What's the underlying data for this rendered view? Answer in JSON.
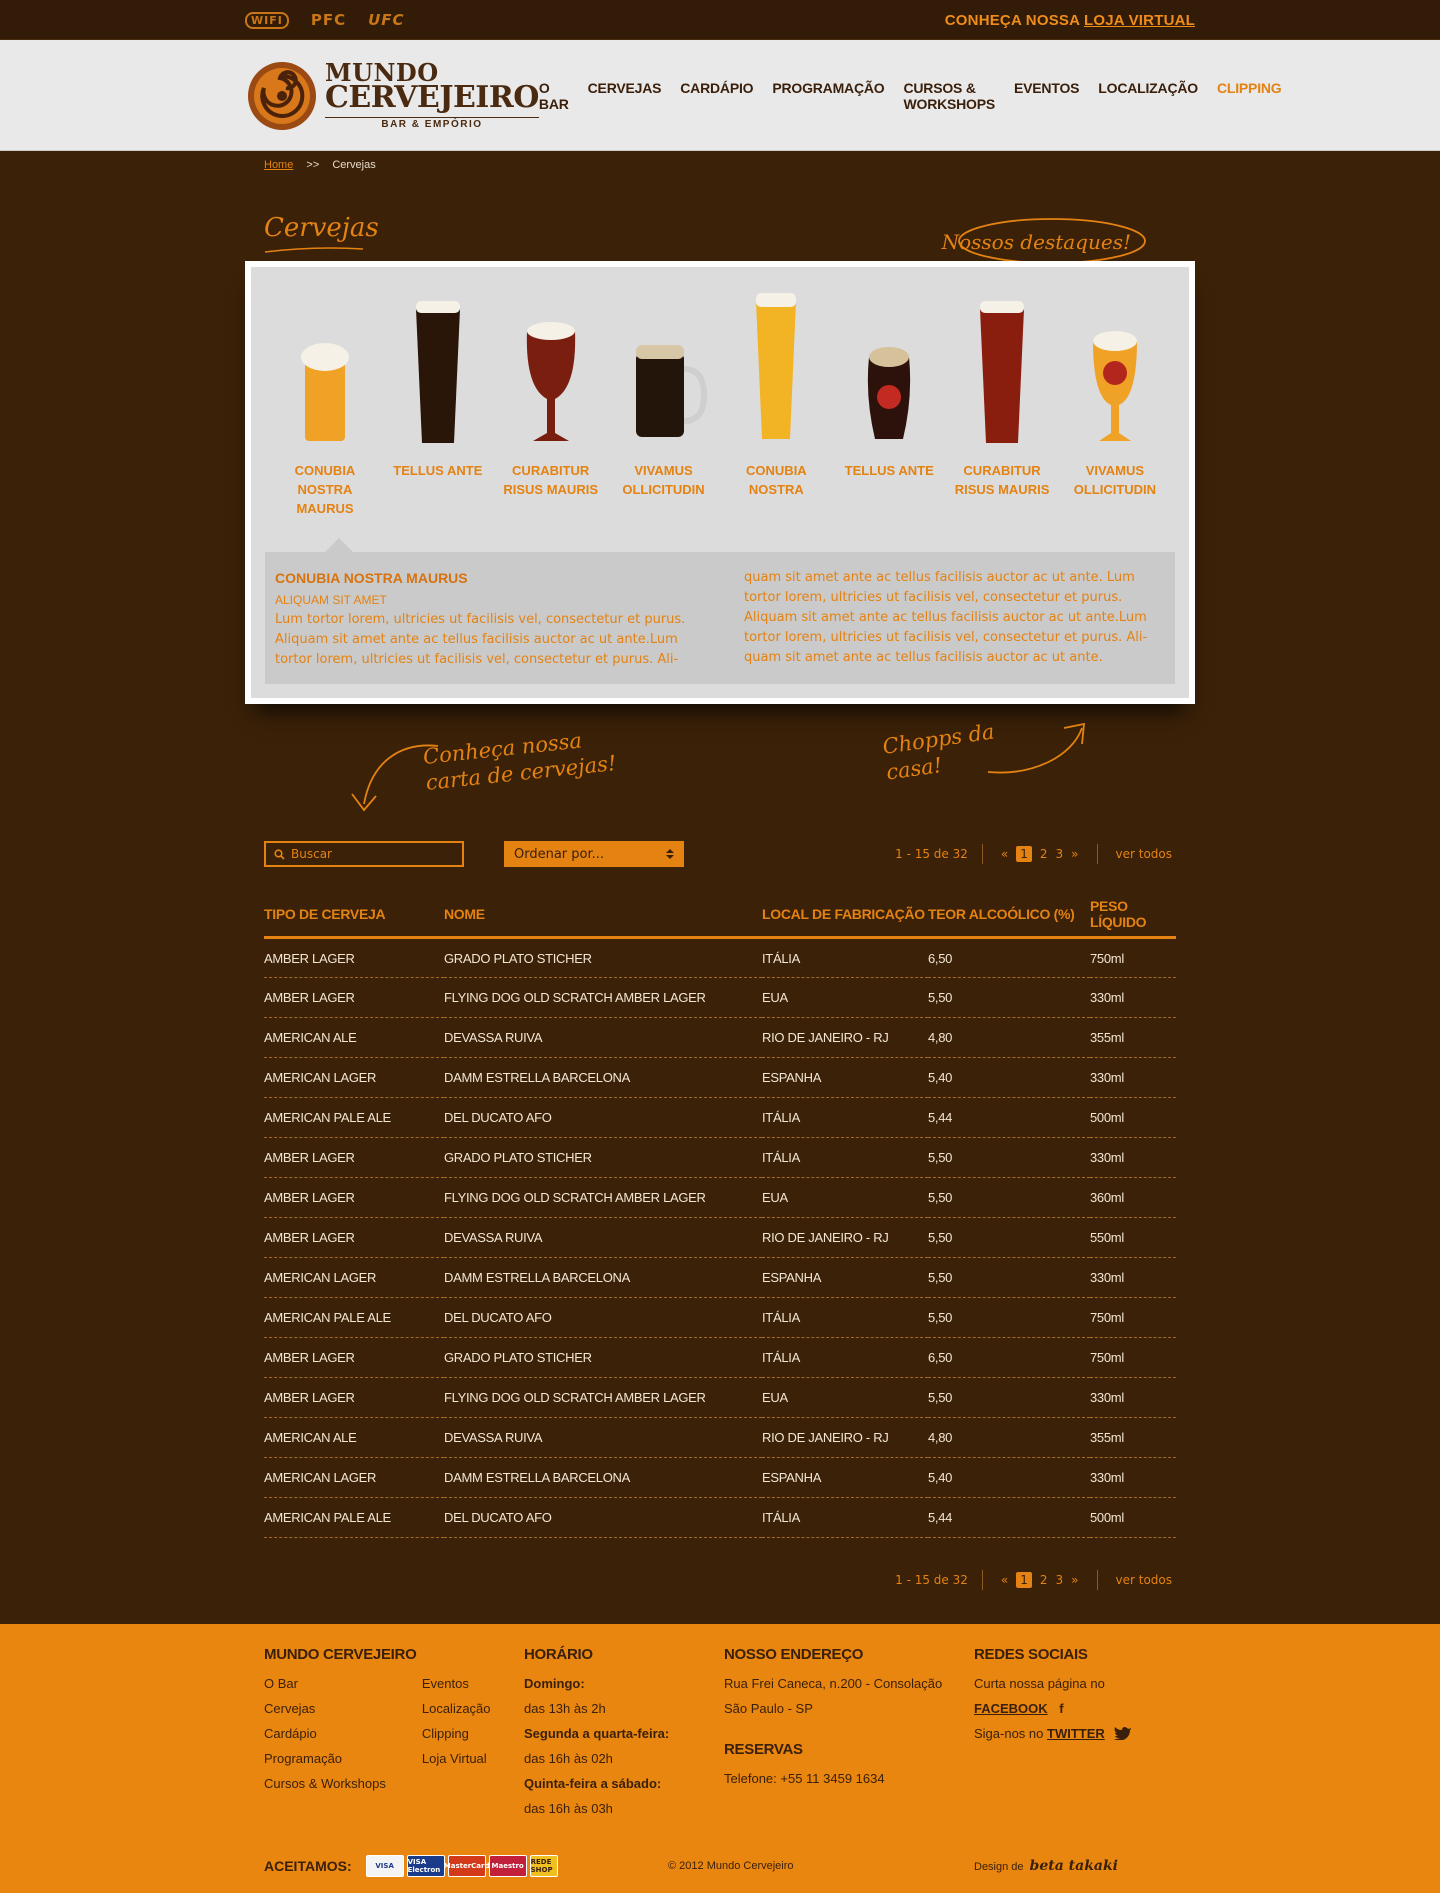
{
  "topbar": {
    "logos": [
      "WIFI",
      "PFC",
      "UFC"
    ],
    "store_prefix": "CONHEÇA NOSSA",
    "store_link": "LOJA VIRTUAL"
  },
  "brand": {
    "line1": "MUNDO",
    "line2": "CERVEJEIRO",
    "line3": "BAR & EMPÓRIO"
  },
  "nav": [
    "O BAR",
    "CERVEJAS",
    "CARDÁPIO",
    "PROGRAMAÇÃO",
    "CURSOS & WORKSHOPS",
    "EVENTOS",
    "LOCALIZAÇÃO",
    "CLIPPING"
  ],
  "nav_active_index": 7,
  "breadcrumb": {
    "home": "Home",
    "separator": ">>",
    "current": "Cervejas"
  },
  "page": {
    "title": "Cervejas",
    "highlights": "Nossos destaques!"
  },
  "featured_beers": [
    {
      "name": "CONUBIA NOSTRA MAURUS",
      "glass": "wheat",
      "color": "#f0a226"
    },
    {
      "name": "TELLUS ANTE",
      "glass": "pint",
      "color": "#2a1608"
    },
    {
      "name": "CURABITUR RISUS MAURIS",
      "glass": "tulip",
      "color": "#7a1e10"
    },
    {
      "name": "VIVAMUS OLLICITUDIN",
      "glass": "mug",
      "color": "#24150a"
    },
    {
      "name": "CONUBIA NOSTRA",
      "glass": "tall",
      "color": "#f2b324"
    },
    {
      "name": "TELLUS ANTE",
      "glass": "stout",
      "color": "#2c120a"
    },
    {
      "name": "CURABITUR RISUS MAURIS",
      "glass": "pint",
      "color": "#8a1e0e"
    },
    {
      "name": "VIVAMUS OLLICITUDIN",
      "glass": "goblet",
      "color": "#f0a226"
    }
  ],
  "description": {
    "title": "CONUBIA NOSTRA MAURUS",
    "subtitle": "ALIQUAM SIT AMET",
    "left_text": "Lum tortor lorem, ultricies ut facilisis vel, consectetur et purus. Aliquam sit amet ante ac tellus facilisis auctor ac ut ante.Lum tortor lorem, ultricies ut facilisis vel, consectetur et purus. Ali-",
    "right_text": "quam sit amet ante ac tellus facilisis auctor ac ut ante. Lum tortor lorem, ultricies ut facilisis vel, consectetur et purus. Aliquam sit amet ante ac tellus facilisis auctor ac ut ante.Lum tortor lorem, ultricies ut facilisis vel, consectetur et purus. Ali- quam sit amet ante ac tellus facilisis auctor ac ut ante."
  },
  "annotations": {
    "left_line1": "Conheça nossa",
    "left_line2": "carta de cervejas!",
    "right_line1": "Chopps da",
    "right_line2": "casa!"
  },
  "toolbar": {
    "search_placeholder": "Buscar",
    "sort_label": "Ordenar por...",
    "range": "1 - 15 de 32",
    "prev": "«",
    "pages": [
      "1",
      "2",
      "3"
    ],
    "current_page": "1",
    "next": "»",
    "view_all": "ver todos"
  },
  "table": {
    "headers": [
      "TIPO DE CERVEJA",
      "NOME",
      "LOCAL DE FABRICAÇÃO",
      "TEOR ALCOÓLICO (%)",
      "PESO LÍQUIDO"
    ],
    "rows": [
      [
        "AMBER LAGER",
        "GRADO PLATO STICHER",
        "ITÁLIA",
        "6,50",
        "750ml"
      ],
      [
        "AMBER LAGER",
        "FLYING DOG OLD SCRATCH AMBER LAGER",
        "EUA",
        "5,50",
        "330ml"
      ],
      [
        "AMERICAN ALE",
        "DEVASSA RUIVA",
        "RIO DE JANEIRO - RJ",
        "4,80",
        "355ml"
      ],
      [
        "AMERICAN LAGER",
        "DAMM ESTRELLA BARCELONA",
        "ESPANHA",
        "5,40",
        "330ml"
      ],
      [
        "AMERICAN PALE ALE",
        "DEL DUCATO AFO",
        "ITÁLIA",
        "5,44",
        "500ml"
      ],
      [
        "AMBER LAGER",
        "GRADO PLATO STICHER",
        "ITÁLIA",
        "5,50",
        "330ml"
      ],
      [
        "AMBER LAGER",
        "FLYING DOG OLD SCRATCH AMBER LAGER",
        "EUA",
        "5,50",
        "360ml"
      ],
      [
        "AMBER LAGER",
        "DEVASSA RUIVA",
        "RIO DE JANEIRO - RJ",
        "5,50",
        "550ml"
      ],
      [
        "AMERICAN LAGER",
        "DAMM ESTRELLA BARCELONA",
        "ESPANHA",
        "5,50",
        "330ml"
      ],
      [
        "AMERICAN PALE ALE",
        "DEL DUCATO AFO",
        "ITÁLIA",
        "5,50",
        "750ml"
      ],
      [
        "AMBER LAGER",
        "GRADO PLATO STICHER",
        "ITÁLIA",
        "6,50",
        "750ml"
      ],
      [
        "AMBER LAGER",
        "FLYING DOG OLD SCRATCH AMBER LAGER",
        "EUA",
        "5,50",
        "330ml"
      ],
      [
        "AMERICAN ALE",
        "DEVASSA RUIVA",
        "RIO DE JANEIRO - RJ",
        "4,80",
        "355ml"
      ],
      [
        "AMERICAN LAGER",
        "DAMM ESTRELLA BARCELONA",
        "ESPANHA",
        "5,40",
        "330ml"
      ],
      [
        "AMERICAN PALE ALE",
        "DEL DUCATO AFO",
        "ITÁLIA",
        "5,44",
        "500ml"
      ]
    ]
  },
  "footer": {
    "col1_title": "MUNDO CERVEJEIRO",
    "col1_links_a": [
      "O Bar",
      "Cervejas",
      "Cardápio",
      "Programação",
      "Cursos & Workshops"
    ],
    "col1_links_b": [
      "Eventos",
      "Localização",
      "Clipping",
      "Loja Virtual"
    ],
    "hours_title": "HORÁRIO",
    "hours": [
      {
        "day": "Domingo:",
        "time": "das 13h às 2h"
      },
      {
        "day": "Segunda a quarta-feira:",
        "time": "das 16h às 02h"
      },
      {
        "day": "Quinta-feira a sábado:",
        "time": "das 16h às 03h"
      }
    ],
    "address_title": "NOSSO ENDEREÇO",
    "address_line1": "Rua Frei Caneca, n.200 - Consolação",
    "address_line2": "São Paulo - SP",
    "reservations_title": "RESERVAS",
    "phone": "Telefone: +55 11 3459 1634",
    "social_title": "REDES SOCIAIS",
    "facebook_prefix": "Curta nossa página no",
    "facebook_link": "FACEBOOK",
    "twitter_prefix": "Siga-nos no",
    "twitter_link": "TWITTER",
    "accept_label": "ACEITAMOS:",
    "cards": [
      "VISA",
      "VISA Electron",
      "MasterCard",
      "Maestro",
      "REDE SHOP"
    ],
    "copyright": "© 2012 Mundo Cervejeiro",
    "design_prefix": "Design de",
    "design_name": "beta takaki"
  },
  "colors": {
    "accent": "#e48212",
    "background": "#3a2108",
    "footer": "#e8860f",
    "header": "#e9e9e9"
  }
}
